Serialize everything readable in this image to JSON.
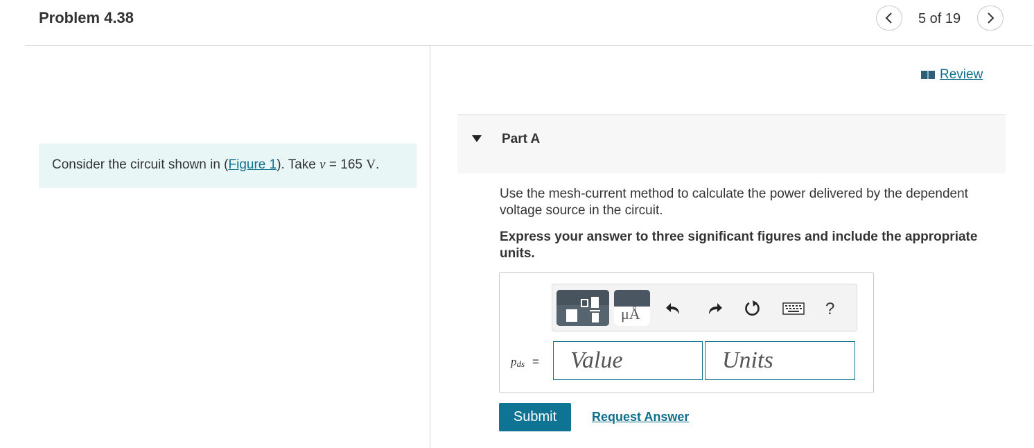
{
  "header": {
    "title": "Problem 4.38",
    "count_label": "5 of 19",
    "prev_icon": "chevron-left-icon",
    "next_icon": "chevron-right-icon"
  },
  "prompt": {
    "text_before": "Consider the circuit shown in (",
    "figure_link": "Figure 1",
    "text_mid": "). Take ",
    "var": "v",
    "eq": " = 165 ",
    "unit": "V",
    "period": "."
  },
  "review": {
    "label": "Review",
    "icon": "book-icon"
  },
  "part": {
    "title": "Part A",
    "question": "Use the mesh-current method to calculate the power delivered by the dependent voltage source in the circuit.",
    "instruction": "Express your answer to three significant figures and include the appropriate units."
  },
  "toolbar": {
    "templates_icon": "templates-icon",
    "units_symbol": "μÅ",
    "undo_icon": "undo-icon",
    "redo_icon": "redo-icon",
    "reset_icon": "reset-icon",
    "keyboard_icon": "keyboard-icon",
    "help_label": "?"
  },
  "answer": {
    "var_main": "p",
    "var_sub": "ds",
    "equals": "=",
    "value_placeholder": "Value",
    "units_placeholder": "Units"
  },
  "actions": {
    "submit_label": "Submit",
    "request_label": "Request Answer"
  },
  "colors": {
    "accent": "#0f7394",
    "link": "#0f6f8f",
    "prompt_bg": "#e9f6f6",
    "part_bg": "#f7f7f7"
  }
}
